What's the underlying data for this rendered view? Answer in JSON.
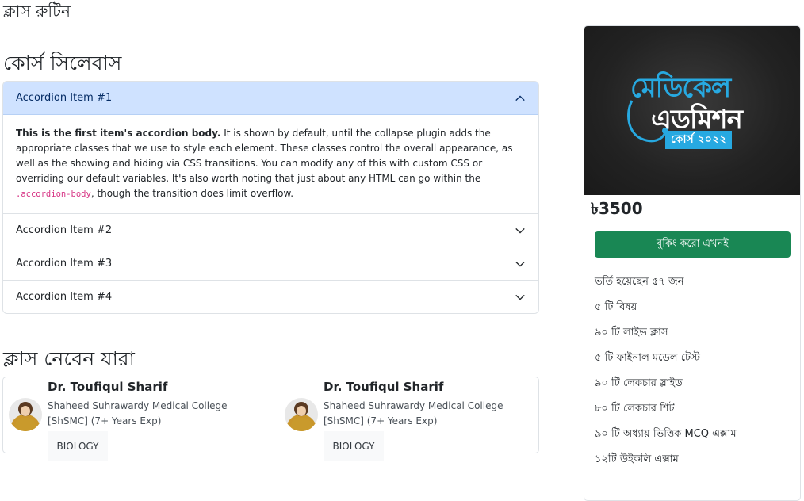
{
  "page": {
    "class_routine_title": "ক্লাস রুটিন",
    "syllabus_title": "কোর্স সিলেবাস",
    "instructors_title": "ক্লাস নেবেন যারা"
  },
  "accordion": {
    "items": [
      {
        "label": "Accordion Item #1",
        "expanded": true,
        "icon": "chevron-up-icon"
      },
      {
        "label": "Accordion Item #2",
        "expanded": false,
        "icon": "chevron-down-icon"
      },
      {
        "label": "Accordion Item #3",
        "expanded": false,
        "icon": "chevron-down-icon"
      },
      {
        "label": "Accordion Item #4",
        "expanded": false,
        "icon": "chevron-down-icon"
      }
    ],
    "body": {
      "bold": "This is the first item's accordion body.",
      "text1": " It is shown by default, until the collapse plugin adds the appropriate classes that we use to style each element. These classes control the overall appearance, as well as the showing and hiding via CSS transitions. You can modify any of this with custom CSS or overriding our default variables. It's also worth noting that just about any HTML can go within the ",
      "code": ".accordion-body",
      "text2": ", though the transition does limit overflow."
    }
  },
  "instructors": [
    {
      "name": "Dr. Toufiqul Sharif",
      "college": "Shaheed Suhrawardy Medical College [ShSMC] (7+ Years Exp)",
      "subject": "BIOLOGY"
    },
    {
      "name": "Dr. Toufiqul Sharif",
      "college": "Shaheed Suhrawardy Medical College [ShSMC] (7+ Years Exp)",
      "subject": "BIOLOGY"
    }
  ],
  "course_card": {
    "banner_line1": "মেডিকেল",
    "banner_line2": "এডমিশন",
    "banner_line3": "কোর্স ২০২২",
    "price": "৳3500",
    "book_button": "বুকিং করো এখনই",
    "features": [
      "ভর্তি হয়েছেন ৫৭ জন",
      "৫ টি বিষয়",
      "৯০ টি লাইভ ক্লাস",
      "৫ টি ফাইনাল মডেল টেস্ট",
      "৯০ টি লেকচার স্লাইড",
      "৮০ টি লেকচার শিট",
      "৯০ টি অধ্যায় ভিত্তিক MCQ এক্সাম",
      "১২টি উইকলি এক্সাম"
    ]
  },
  "colors": {
    "accordion_active_bg": "#cfe2ff",
    "book_button_bg": "#198754",
    "banner_accent": "#27a9e1"
  }
}
